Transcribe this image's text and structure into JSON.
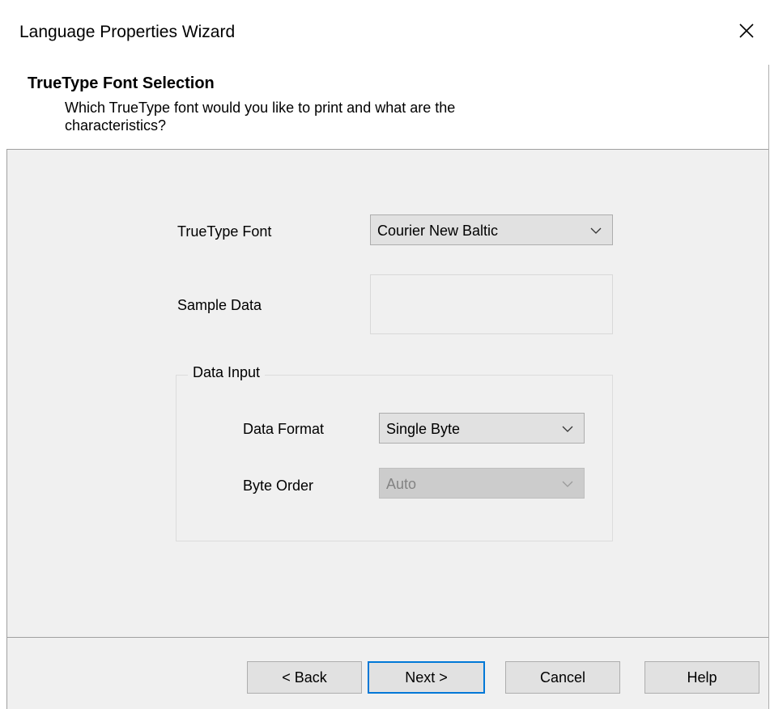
{
  "window": {
    "title": "Language Properties Wizard"
  },
  "header": {
    "title": "TrueType Font Selection",
    "subtitle": "Which TrueType font would you like to print and what are the characteristics?"
  },
  "form": {
    "truetype_font_label": "TrueType Font",
    "truetype_font_value": "Courier New Baltic",
    "sample_data_label": "Sample Data",
    "sample_data_value": "",
    "data_input_group_label": "Data Input",
    "data_format_label": "Data Format",
    "data_format_value": "Single Byte",
    "byte_order_label": "Byte Order",
    "byte_order_value": "Auto",
    "byte_order_disabled": true
  },
  "buttons": {
    "back": "< Back",
    "next": "Next >",
    "cancel": "Cancel",
    "help": "Help"
  },
  "icons": {
    "close": "close-icon",
    "dropdown": "chevron-down-icon"
  },
  "colors": {
    "accent": "#0078d7",
    "dialog_background": "#f0f0f0",
    "button_face": "#e1e1e1"
  }
}
